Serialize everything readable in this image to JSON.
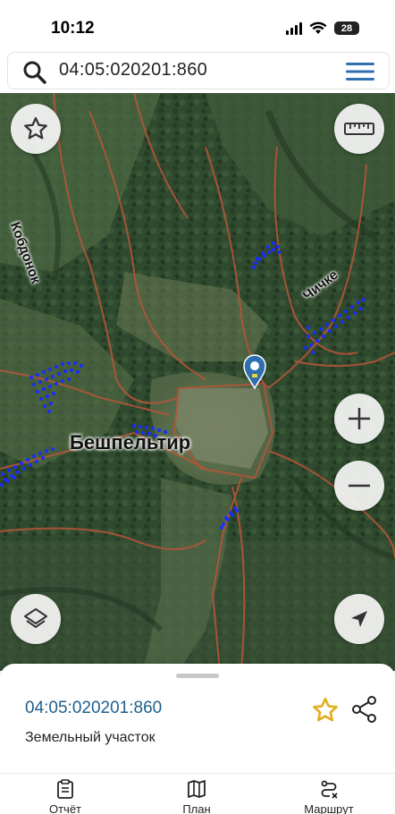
{
  "status_bar": {
    "time": "10:12",
    "battery": "28"
  },
  "search": {
    "query": "04:05:020201:860"
  },
  "map": {
    "labels": {
      "village": "Бешпельтир",
      "river_left": "Кобдонок",
      "river_right": "Чичке"
    }
  },
  "sheet": {
    "title": "04:05:020201:860",
    "subtitle": "Земельный участок"
  },
  "tabs": [
    {
      "label": "Отчёт",
      "icon": "report-icon"
    },
    {
      "label": "План",
      "icon": "map-plan-icon"
    },
    {
      "label": "Маршрут",
      "icon": "route-icon"
    }
  ],
  "colors": {
    "accent": "#1f5f8b",
    "favorite": "#e0b021",
    "parcel_boundary": "#b4553a",
    "parcel_markers": "#1a2cff",
    "pin": "#2f6fb0"
  }
}
